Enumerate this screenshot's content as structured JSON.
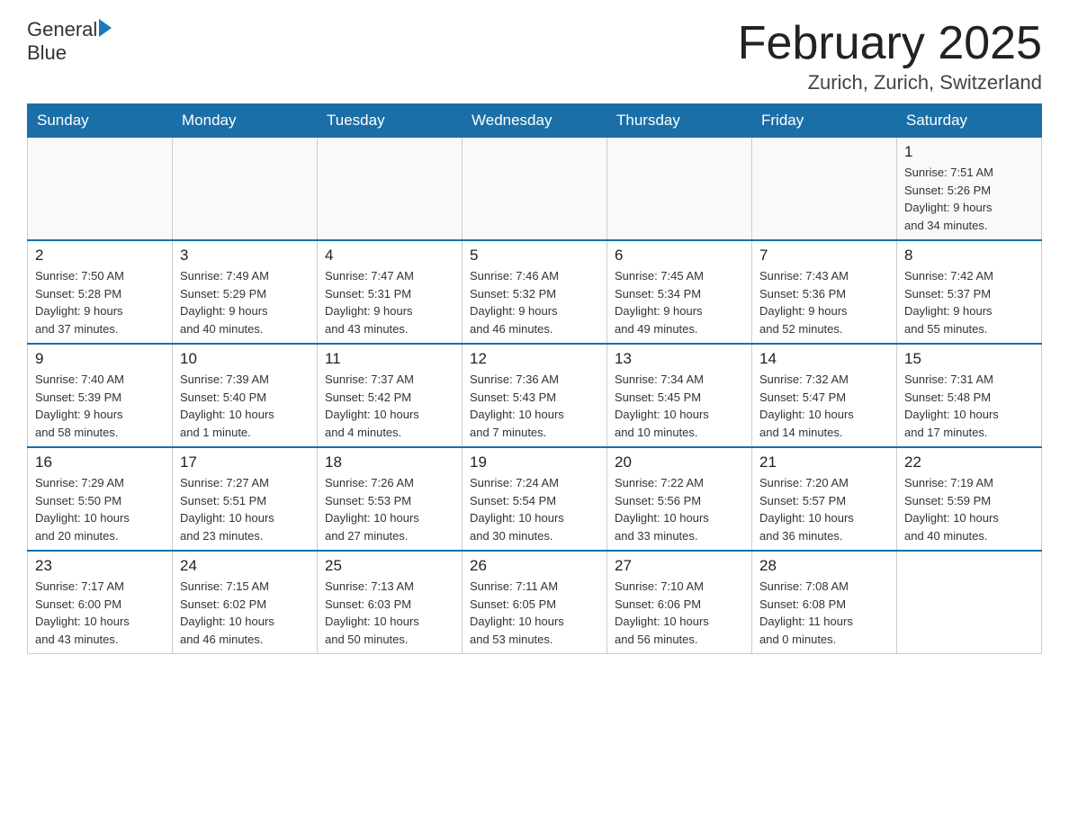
{
  "header": {
    "logo_general": "General",
    "logo_blue": "Blue",
    "month_title": "February 2025",
    "location": "Zurich, Zurich, Switzerland"
  },
  "calendar": {
    "days_of_week": [
      "Sunday",
      "Monday",
      "Tuesday",
      "Wednesday",
      "Thursday",
      "Friday",
      "Saturday"
    ],
    "weeks": [
      [
        {
          "day": "",
          "info": ""
        },
        {
          "day": "",
          "info": ""
        },
        {
          "day": "",
          "info": ""
        },
        {
          "day": "",
          "info": ""
        },
        {
          "day": "",
          "info": ""
        },
        {
          "day": "",
          "info": ""
        },
        {
          "day": "1",
          "info": "Sunrise: 7:51 AM\nSunset: 5:26 PM\nDaylight: 9 hours\nand 34 minutes."
        }
      ],
      [
        {
          "day": "2",
          "info": "Sunrise: 7:50 AM\nSunset: 5:28 PM\nDaylight: 9 hours\nand 37 minutes."
        },
        {
          "day": "3",
          "info": "Sunrise: 7:49 AM\nSunset: 5:29 PM\nDaylight: 9 hours\nand 40 minutes."
        },
        {
          "day": "4",
          "info": "Sunrise: 7:47 AM\nSunset: 5:31 PM\nDaylight: 9 hours\nand 43 minutes."
        },
        {
          "day": "5",
          "info": "Sunrise: 7:46 AM\nSunset: 5:32 PM\nDaylight: 9 hours\nand 46 minutes."
        },
        {
          "day": "6",
          "info": "Sunrise: 7:45 AM\nSunset: 5:34 PM\nDaylight: 9 hours\nand 49 minutes."
        },
        {
          "day": "7",
          "info": "Sunrise: 7:43 AM\nSunset: 5:36 PM\nDaylight: 9 hours\nand 52 minutes."
        },
        {
          "day": "8",
          "info": "Sunrise: 7:42 AM\nSunset: 5:37 PM\nDaylight: 9 hours\nand 55 minutes."
        }
      ],
      [
        {
          "day": "9",
          "info": "Sunrise: 7:40 AM\nSunset: 5:39 PM\nDaylight: 9 hours\nand 58 minutes."
        },
        {
          "day": "10",
          "info": "Sunrise: 7:39 AM\nSunset: 5:40 PM\nDaylight: 10 hours\nand 1 minute."
        },
        {
          "day": "11",
          "info": "Sunrise: 7:37 AM\nSunset: 5:42 PM\nDaylight: 10 hours\nand 4 minutes."
        },
        {
          "day": "12",
          "info": "Sunrise: 7:36 AM\nSunset: 5:43 PM\nDaylight: 10 hours\nand 7 minutes."
        },
        {
          "day": "13",
          "info": "Sunrise: 7:34 AM\nSunset: 5:45 PM\nDaylight: 10 hours\nand 10 minutes."
        },
        {
          "day": "14",
          "info": "Sunrise: 7:32 AM\nSunset: 5:47 PM\nDaylight: 10 hours\nand 14 minutes."
        },
        {
          "day": "15",
          "info": "Sunrise: 7:31 AM\nSunset: 5:48 PM\nDaylight: 10 hours\nand 17 minutes."
        }
      ],
      [
        {
          "day": "16",
          "info": "Sunrise: 7:29 AM\nSunset: 5:50 PM\nDaylight: 10 hours\nand 20 minutes."
        },
        {
          "day": "17",
          "info": "Sunrise: 7:27 AM\nSunset: 5:51 PM\nDaylight: 10 hours\nand 23 minutes."
        },
        {
          "day": "18",
          "info": "Sunrise: 7:26 AM\nSunset: 5:53 PM\nDaylight: 10 hours\nand 27 minutes."
        },
        {
          "day": "19",
          "info": "Sunrise: 7:24 AM\nSunset: 5:54 PM\nDaylight: 10 hours\nand 30 minutes."
        },
        {
          "day": "20",
          "info": "Sunrise: 7:22 AM\nSunset: 5:56 PM\nDaylight: 10 hours\nand 33 minutes."
        },
        {
          "day": "21",
          "info": "Sunrise: 7:20 AM\nSunset: 5:57 PM\nDaylight: 10 hours\nand 36 minutes."
        },
        {
          "day": "22",
          "info": "Sunrise: 7:19 AM\nSunset: 5:59 PM\nDaylight: 10 hours\nand 40 minutes."
        }
      ],
      [
        {
          "day": "23",
          "info": "Sunrise: 7:17 AM\nSunset: 6:00 PM\nDaylight: 10 hours\nand 43 minutes."
        },
        {
          "day": "24",
          "info": "Sunrise: 7:15 AM\nSunset: 6:02 PM\nDaylight: 10 hours\nand 46 minutes."
        },
        {
          "day": "25",
          "info": "Sunrise: 7:13 AM\nSunset: 6:03 PM\nDaylight: 10 hours\nand 50 minutes."
        },
        {
          "day": "26",
          "info": "Sunrise: 7:11 AM\nSunset: 6:05 PM\nDaylight: 10 hours\nand 53 minutes."
        },
        {
          "day": "27",
          "info": "Sunrise: 7:10 AM\nSunset: 6:06 PM\nDaylight: 10 hours\nand 56 minutes."
        },
        {
          "day": "28",
          "info": "Sunrise: 7:08 AM\nSunset: 6:08 PM\nDaylight: 11 hours\nand 0 minutes."
        },
        {
          "day": "",
          "info": ""
        }
      ]
    ]
  }
}
